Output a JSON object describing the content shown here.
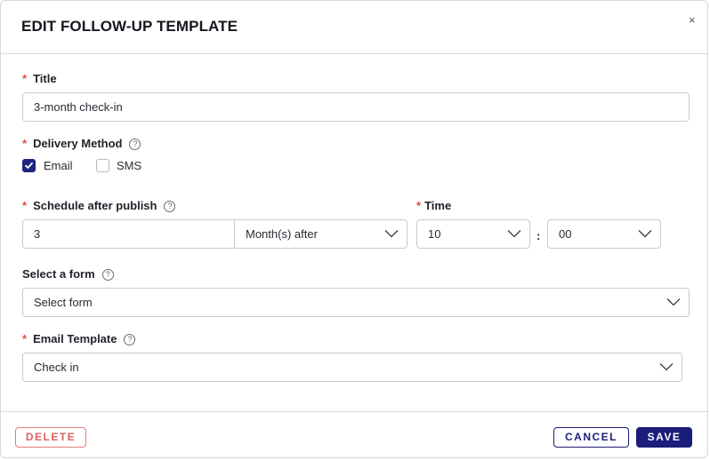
{
  "dialog": {
    "title": "EDIT FOLLOW-UP TEMPLATE",
    "close_glyph": "×"
  },
  "title_field": {
    "label": "Title",
    "required_mark": "*",
    "value": "3-month check-in"
  },
  "delivery": {
    "label": "Delivery Method",
    "required_mark": "*",
    "help_glyph": "?",
    "options": [
      {
        "label": "Email",
        "checked": true
      },
      {
        "label": "SMS",
        "checked": false
      }
    ]
  },
  "schedule": {
    "label": "Schedule after publish",
    "required_mark": "*",
    "help_glyph": "?",
    "amount": "3",
    "unit": "Month(s) after"
  },
  "time": {
    "label": "Time",
    "required_mark": "*",
    "hour": "10",
    "separator": ":",
    "minute": "00"
  },
  "form_select": {
    "label": "Select a form",
    "help_glyph": "?",
    "placeholder": "Select form"
  },
  "email_template": {
    "label": "Email Template",
    "required_mark": "*",
    "help_glyph": "?",
    "value": "Check in"
  },
  "footer": {
    "delete_label": "DELETE",
    "cancel_label": "CANCEL",
    "save_label": "SAVE"
  },
  "colors": {
    "primary": "#1a1d7a",
    "danger": "#e06060",
    "required": "#e14b4b"
  },
  "icons": {
    "close": "close-icon",
    "help": "question-circle-icon",
    "dropdown": "chevron-down-icon",
    "checkbox": "checkmark-icon"
  }
}
